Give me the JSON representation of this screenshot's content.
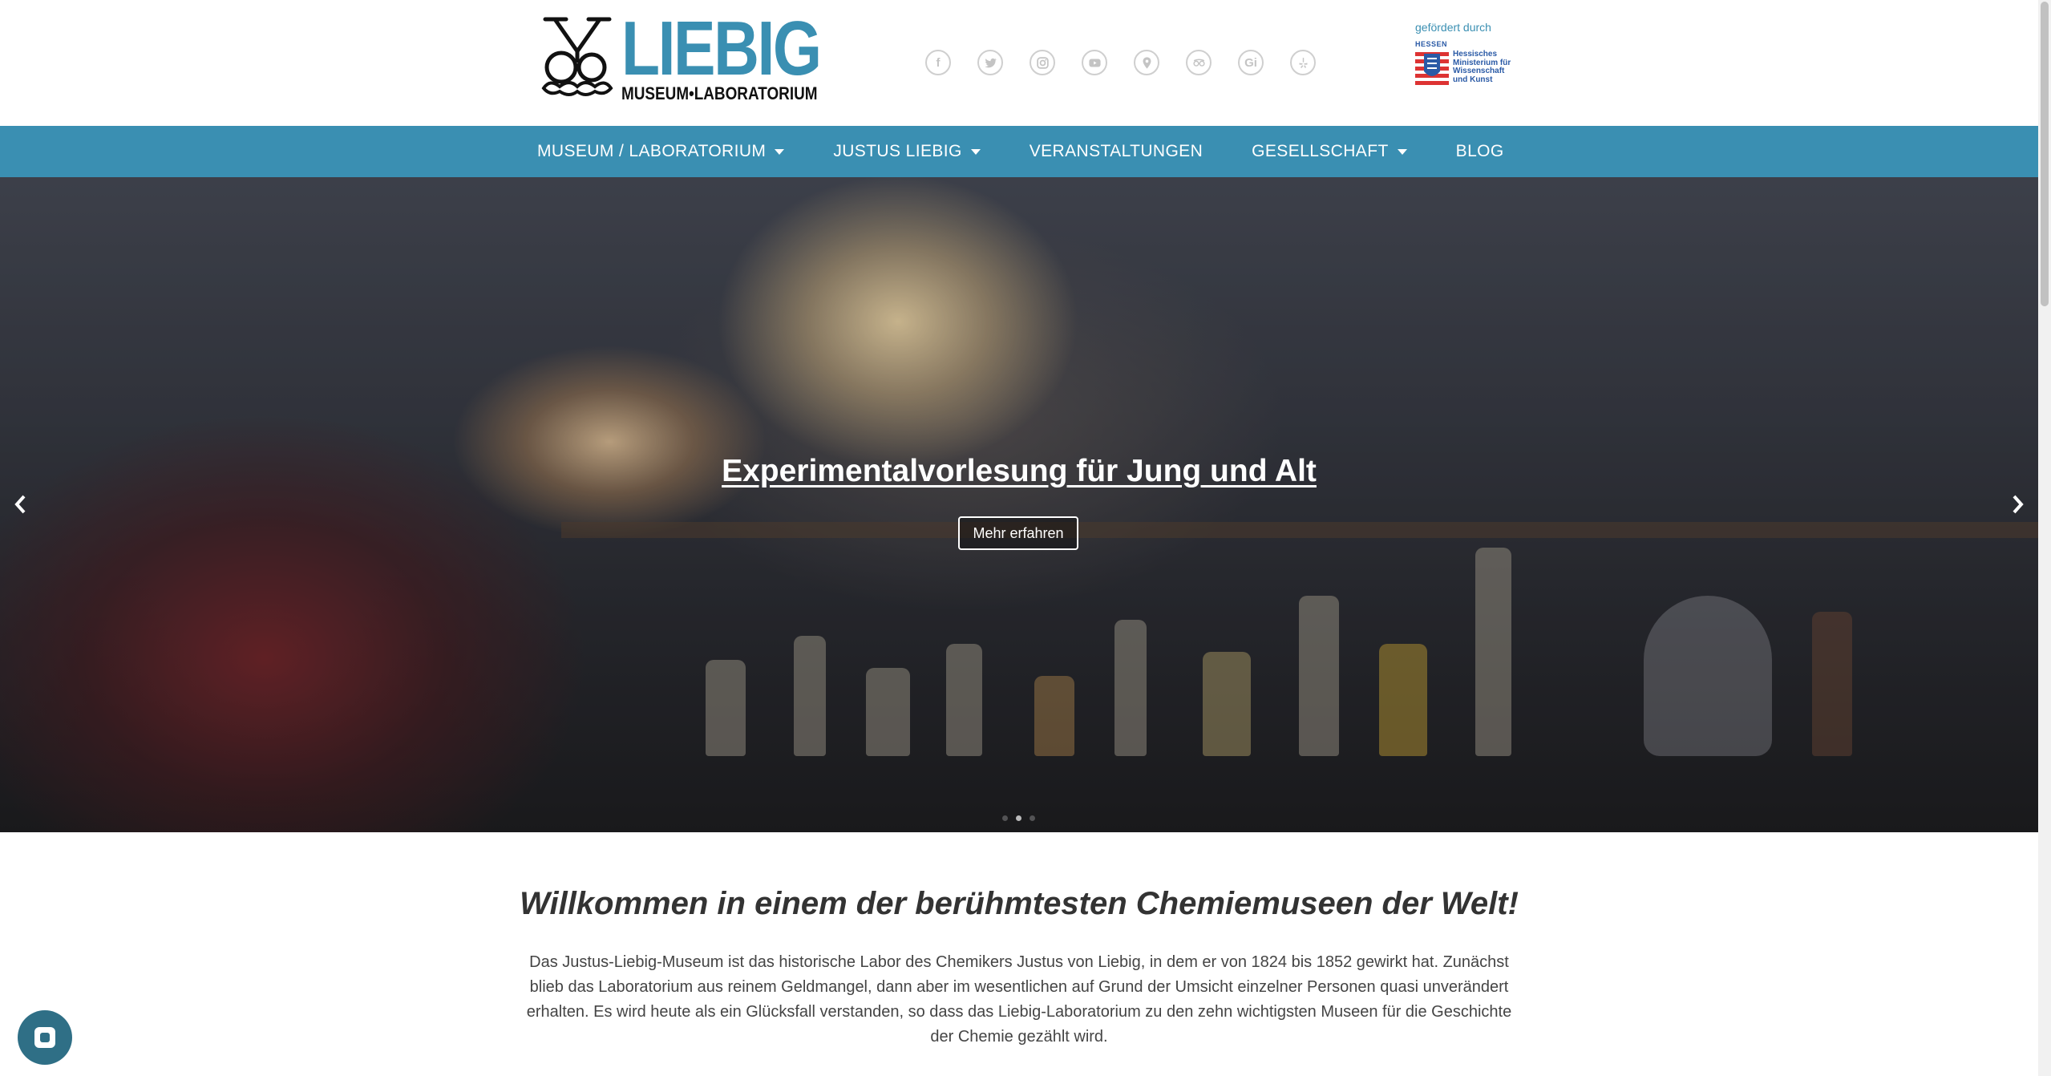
{
  "header": {
    "logo": {
      "title": "LIEBIG",
      "subtitle": "MUSEUM•LABORATORIUM"
    },
    "socials": [
      {
        "icon": "facebook-icon",
        "glyph": "f"
      },
      {
        "icon": "twitter-icon",
        "glyph": ""
      },
      {
        "icon": "instagram-icon",
        "glyph": ""
      },
      {
        "icon": "youtube-icon",
        "glyph": ""
      },
      {
        "icon": "location-pin-icon",
        "glyph": ""
      },
      {
        "icon": "tripadvisor-icon",
        "glyph": ""
      },
      {
        "icon": "gi-icon",
        "glyph": "Gi"
      },
      {
        "icon": "yelp-icon",
        "glyph": ""
      }
    ],
    "sponsor": {
      "label": "gefördert durch",
      "state": "HESSEN",
      "ministry": "Hessisches Ministerium für Wissenschaft und Kunst"
    }
  },
  "nav": {
    "items": [
      {
        "label": "MUSEUM / LABORATORIUM",
        "dropdown": true
      },
      {
        "label": "JUSTUS LIEBIG",
        "dropdown": true
      },
      {
        "label": "VERANSTALTUNGEN",
        "dropdown": false
      },
      {
        "label": "GESELLSCHAFT",
        "dropdown": true
      },
      {
        "label": "BLOG",
        "dropdown": false
      }
    ]
  },
  "hero": {
    "title": "Experimentalvorlesung für Jung und Alt",
    "button": "Mehr erfahren"
  },
  "content": {
    "welcome": "Willkommen in einem der berühmtesten Chemiemuseen der Welt!",
    "intro": "Das Justus-Liebig-Museum ist das historische Labor des Chemikers Justus von Liebig, in dem er von 1824 bis 1852 gewirkt hat. Zunächst blieb das Laboratorium aus reinem Geldmangel, dann aber im wesentlichen auf Grund der Umsicht einzelner Personen quasi unverändert erhalten. Es wird heute als ein Glücksfall verstanden, so dass das Liebig-Laboratorium zu den zehn wichtigsten Museen für die Geschichte der Chemie gezählt wird."
  },
  "colors": {
    "brand": "#3a8fb2",
    "chat": "#2f6f86"
  }
}
